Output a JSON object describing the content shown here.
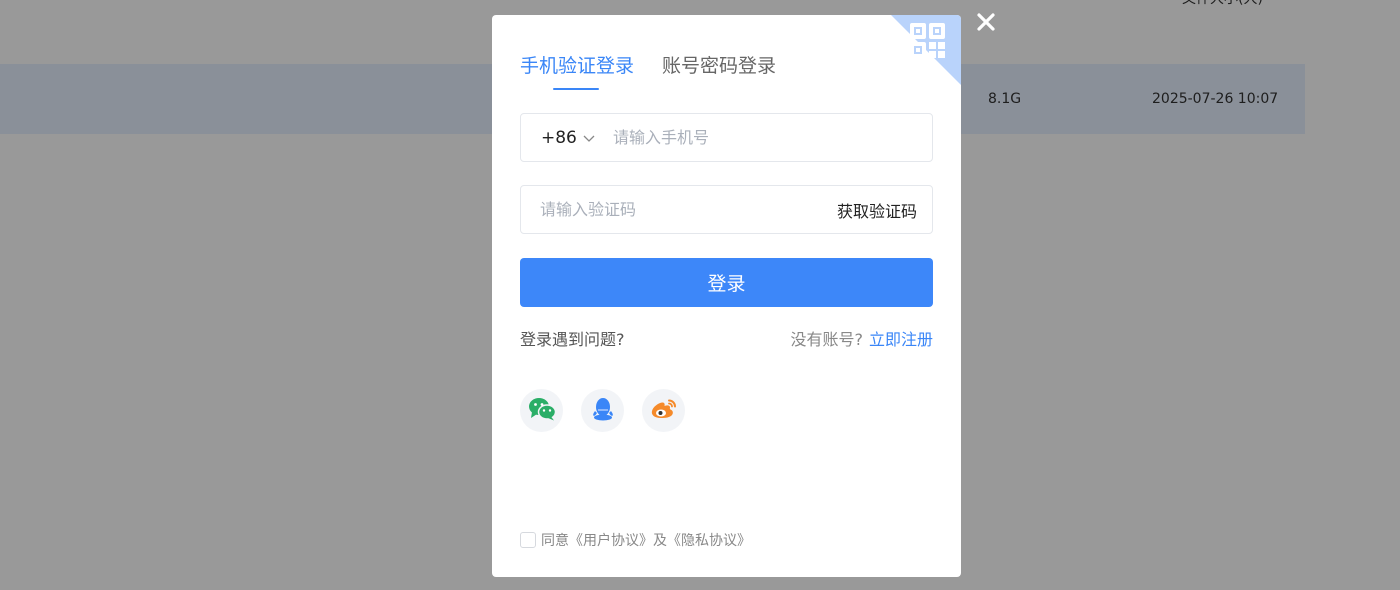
{
  "background": {
    "header_partial_text": "文件大小(大)",
    "row": {
      "size": "8.1G",
      "date": "2025-07-26 10:07"
    }
  },
  "modal": {
    "close_icon": "close-icon",
    "qr_icon": "qr-code-icon",
    "tabs": [
      {
        "label": "手机验证登录",
        "active": true
      },
      {
        "label": "账号密码登录",
        "active": false
      }
    ],
    "phone": {
      "country_code": "+86",
      "placeholder": "请输入手机号",
      "value": ""
    },
    "code": {
      "placeholder": "请输入验证码",
      "value": "",
      "get_code_label": "获取验证码"
    },
    "login_label": "登录",
    "trouble_label": "登录遇到问题?",
    "no_account_label": "没有账号?",
    "register_label": "立即注册",
    "socials": [
      {
        "name": "wechat",
        "icon": "wechat-icon",
        "color": "#2aae67"
      },
      {
        "name": "qq",
        "icon": "qq-icon",
        "color": "#3a86f7"
      },
      {
        "name": "weibo",
        "icon": "weibo-icon",
        "color": "#f58a2a"
      }
    ],
    "agreement": {
      "prefix": "同意",
      "user_agreement": "《用户协议》",
      "and": "及",
      "privacy_agreement": "《隐私协议》"
    }
  },
  "colors": {
    "accent": "#3a86f7",
    "button": "#3d87f9",
    "overlay": "rgba(0,0,0,0.4)"
  }
}
